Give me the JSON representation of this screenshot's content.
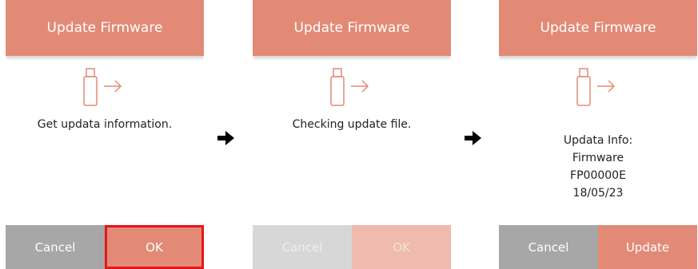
{
  "screens": [
    {
      "title": "Update Firmware",
      "icon": "usb-drive-icon",
      "message": "Get updata information.",
      "buttons": {
        "cancel": "Cancel",
        "confirm": "OK"
      },
      "highlighted_button": "confirm"
    },
    {
      "title": "Update Firmware",
      "icon": "usb-drive-icon",
      "message": "Checking update file.",
      "buttons": {
        "cancel": "Cancel",
        "confirm": "OK"
      },
      "buttons_disabled": true
    },
    {
      "title": "Update Firmware",
      "icon": "usb-drive-icon",
      "info_lines": [
        "Updata Info:",
        "Firmware",
        "FP00000E",
        "18/05/23"
      ],
      "buttons": {
        "cancel": "Cancel",
        "confirm": "Update"
      }
    }
  ],
  "flow_arrow_icon": "right-arrow-icon",
  "colors": {
    "accent": "#e28a76",
    "cancel_gray": "#a7a7a7",
    "highlight_red": "#e8141a"
  }
}
